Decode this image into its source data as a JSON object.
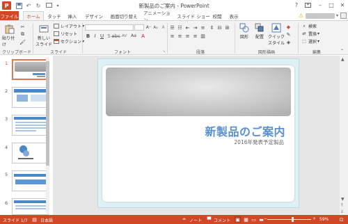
{
  "window": {
    "title": "新製品のご案内 - PowerPoint",
    "app_logo": "P",
    "qat_icons": [
      "save-icon",
      "undo-icon",
      "redo-icon",
      "present-icon",
      "customize-icon"
    ],
    "controls": [
      "help",
      "ribbon-display",
      "minimize",
      "maximize",
      "close"
    ]
  },
  "tabs": [
    "ファイル",
    "ホーム",
    "タッチ",
    "挿入",
    "デザイン",
    "画面切り替え",
    "アニメーション",
    "スライド ショー",
    "校閲",
    "表示"
  ],
  "active_tab": "ホーム",
  "ribbon": {
    "clipboard": {
      "paste": "貼り付け",
      "label": "クリップボード"
    },
    "slides": {
      "new_slide_line1": "新しい",
      "new_slide_line2": "スライド",
      "layout": "レイアウト",
      "reset": "リセット",
      "section": "セクション",
      "label": "スライド"
    },
    "font": {
      "label": "フォント",
      "case_btn": "Aa"
    },
    "paragraph": {
      "label": "段落"
    },
    "drawing": {
      "shapes": "図形",
      "arrange": "配置",
      "quick_styles_line1": "クイック",
      "quick_styles_line2": "スタイル",
      "label": "図形描画"
    },
    "editing": {
      "find": "検索",
      "replace": "置換",
      "select": "選択",
      "label": "編集"
    }
  },
  "thumbnails": [
    {
      "num": "1",
      "selected": true
    },
    {
      "num": "2",
      "selected": false
    },
    {
      "num": "3",
      "selected": false
    },
    {
      "num": "4",
      "selected": false
    },
    {
      "num": "5",
      "selected": false
    },
    {
      "num": "6",
      "selected": false
    }
  ],
  "slide": {
    "title": "新製品のご案内",
    "subtitle": "2016年発表予定製品"
  },
  "status": {
    "slide_indicator": "スライド 1/7",
    "language": "日本語",
    "notes": "ノート",
    "comments": "コメント",
    "zoom": "59%",
    "zoom_fraction": 0.59
  },
  "colors": {
    "accent": "#d24726",
    "title_blue": "#5a8fd0",
    "slide_border": "#dff1f4"
  }
}
